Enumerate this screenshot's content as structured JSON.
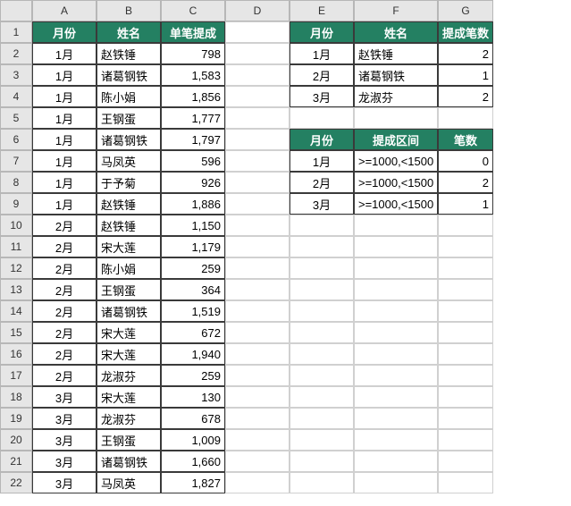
{
  "colHeaders": [
    "A",
    "B",
    "C",
    "D",
    "E",
    "F",
    "G"
  ],
  "rowCount": 22,
  "table1": {
    "headers": {
      "month": "月份",
      "name": "姓名",
      "amount": "单笔提成"
    },
    "rows": [
      {
        "month": "1月",
        "name": "赵铁锤",
        "amount": "798"
      },
      {
        "month": "1月",
        "name": "诸葛钢铁",
        "amount": "1,583"
      },
      {
        "month": "1月",
        "name": "陈小娟",
        "amount": "1,856"
      },
      {
        "month": "1月",
        "name": "王钢蛋",
        "amount": "1,777"
      },
      {
        "month": "1月",
        "name": "诸葛钢铁",
        "amount": "1,797"
      },
      {
        "month": "1月",
        "name": "马凤英",
        "amount": "596"
      },
      {
        "month": "1月",
        "name": "于予菊",
        "amount": "926"
      },
      {
        "month": "1月",
        "name": "赵铁锤",
        "amount": "1,886"
      },
      {
        "month": "2月",
        "name": "赵铁锤",
        "amount": "1,150"
      },
      {
        "month": "2月",
        "name": "宋大莲",
        "amount": "1,179"
      },
      {
        "month": "2月",
        "name": "陈小娟",
        "amount": "259"
      },
      {
        "month": "2月",
        "name": "王钢蛋",
        "amount": "364"
      },
      {
        "month": "2月",
        "name": "诸葛钢铁",
        "amount": "1,519"
      },
      {
        "month": "2月",
        "name": "宋大莲",
        "amount": "672"
      },
      {
        "month": "2月",
        "name": "宋大莲",
        "amount": "1,940"
      },
      {
        "month": "2月",
        "name": "龙淑芬",
        "amount": "259"
      },
      {
        "month": "3月",
        "name": "宋大莲",
        "amount": "130"
      },
      {
        "month": "3月",
        "name": "龙淑芬",
        "amount": "678"
      },
      {
        "month": "3月",
        "name": "王钢蛋",
        "amount": "1,009"
      },
      {
        "month": "3月",
        "name": "诸葛钢铁",
        "amount": "1,660"
      },
      {
        "month": "3月",
        "name": "马凤英",
        "amount": "1,827"
      }
    ]
  },
  "table2": {
    "headers": {
      "month": "月份",
      "name": "姓名",
      "count": "提成笔数"
    },
    "rows": [
      {
        "month": "1月",
        "name": "赵铁锤",
        "count": "2"
      },
      {
        "month": "2月",
        "name": "诸葛钢铁",
        "count": "1"
      },
      {
        "month": "3月",
        "name": "龙淑芬",
        "count": "2"
      }
    ]
  },
  "table3": {
    "headers": {
      "month": "月份",
      "range": "提成区间",
      "count": "笔数"
    },
    "rows": [
      {
        "month": "1月",
        "range": ">=1000,<1500",
        "count": "0"
      },
      {
        "month": "2月",
        "range": ">=1000,<1500",
        "count": "2"
      },
      {
        "month": "3月",
        "range": ">=1000,<1500",
        "count": "1"
      }
    ]
  }
}
